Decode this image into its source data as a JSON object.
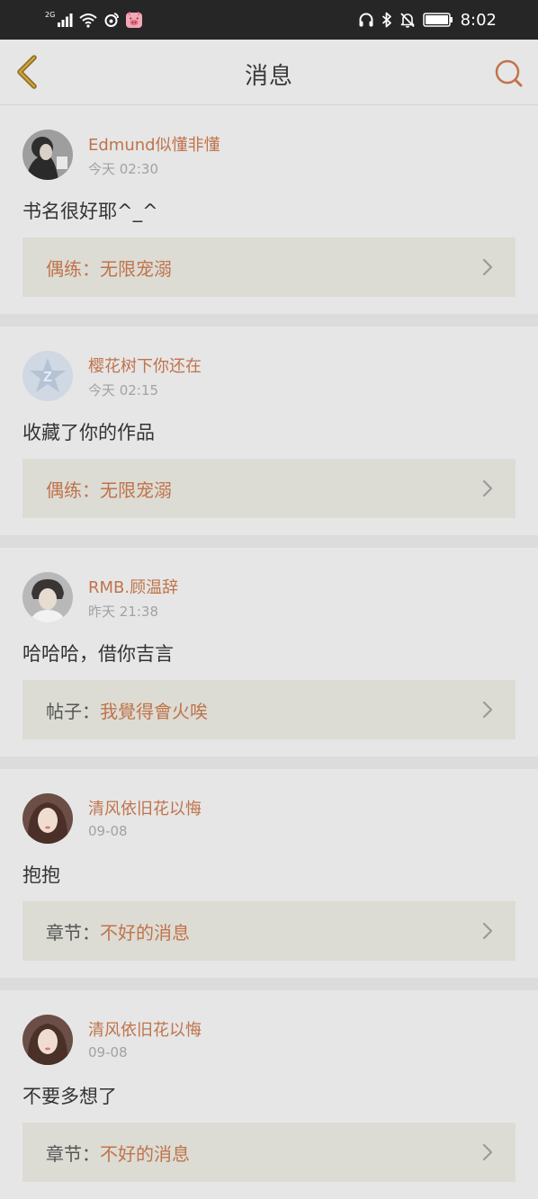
{
  "status_bar": {
    "network_generation": "2G",
    "time": "8:02"
  },
  "header": {
    "title": "消息"
  },
  "messages": [
    {
      "username": "Edmund似懂非懂",
      "time": "今天 02:30",
      "content": "书名很好耶^_^",
      "ref_type": "偶练：",
      "ref_title": "无限宠溺"
    },
    {
      "username": "樱花树下你还在",
      "time": "今天 02:15",
      "content": "收藏了你的作品",
      "ref_type": "偶练：",
      "ref_title": "无限宠溺"
    },
    {
      "username": "RMB.顾温辞",
      "time": "昨天 21:38",
      "content": "哈哈哈，借你吉言",
      "ref_type": "帖子：",
      "ref_title": "我覺得會火唉"
    },
    {
      "username": "清风依旧花以悔",
      "time": "09-08",
      "content": "抱抱",
      "ref_type": "章节：",
      "ref_title": "不好的消息"
    },
    {
      "username": "清风依旧花以悔",
      "time": "09-08",
      "content": "不要多想了",
      "ref_type": "章节：",
      "ref_title": "不好的消息"
    }
  ],
  "colors": {
    "accent": "#c0734b",
    "page_bg": "#e6e6e6",
    "ref_bg": "#dcdcd4",
    "status_bar_bg": "#262626"
  }
}
